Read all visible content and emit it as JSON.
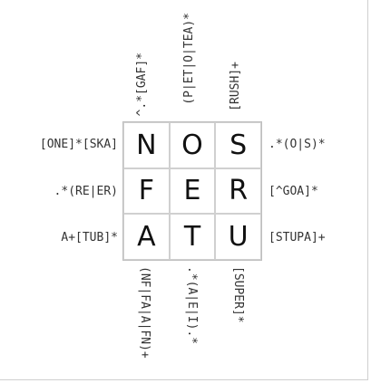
{
  "top_clues": [
    "^.*[GAF]*",
    "(P|ET|O|TEA)*",
    "[RUSH]+"
  ],
  "bottom_clues": [
    "(NF|FA|A|FN)+",
    ".*(A|E|I).*",
    "[SUPER]*"
  ],
  "left_clues": [
    "[ONE]*[SKA]",
    ".*(RE|ER)",
    "A+[TUB]*"
  ],
  "right_clues": [
    ".*(O|S)*",
    "[^GOA]*",
    "[STUPA]+"
  ],
  "grid": [
    [
      "N",
      "O",
      "S"
    ],
    [
      "F",
      "E",
      "R"
    ],
    [
      "A",
      "T",
      "U"
    ]
  ]
}
